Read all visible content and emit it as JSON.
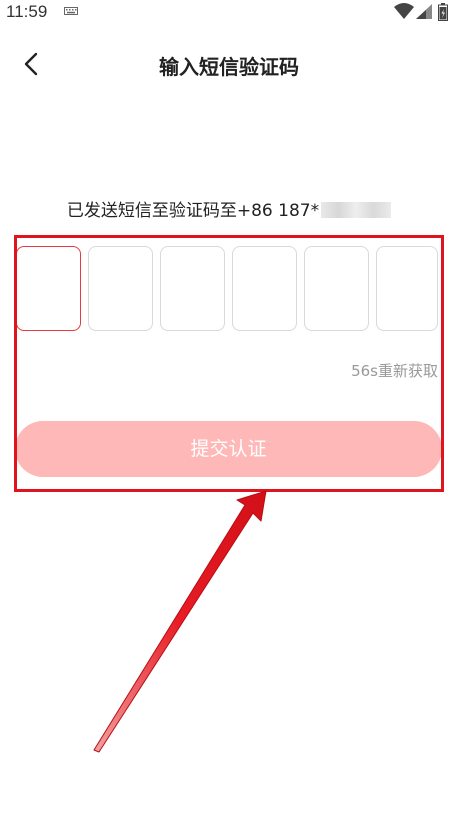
{
  "status_bar": {
    "time": "11:59"
  },
  "header": {
    "title": "输入短信验证码"
  },
  "verification": {
    "sent_text": "已发送短信至验证码至+86 187*",
    "code_boxes": [
      "",
      "",
      "",
      "",
      "",
      ""
    ],
    "resend_text": "56s重新获取",
    "submit_label": "提交认证"
  },
  "colors": {
    "accent": "#e43b3b",
    "submit_disabled": "#ffb8b8",
    "annotation": "#e0141e"
  },
  "icons": [
    "back-arrow-icon",
    "keyboard-icon",
    "wifi-icon",
    "signal-icon",
    "battery-icon"
  ]
}
